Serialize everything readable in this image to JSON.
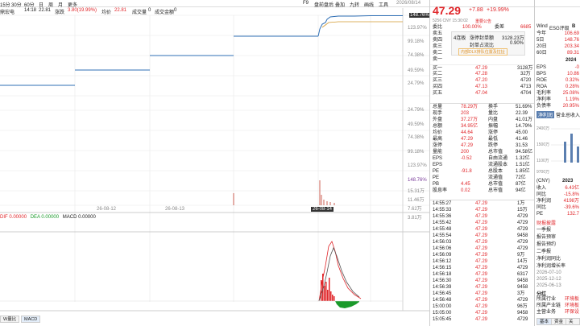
{
  "topbar": {
    "items": [
      "F9",
      "盘前盘后",
      "叠加",
      "九转",
      "画线",
      "工具"
    ],
    "date": "2026/08/14"
  },
  "toolbar": {
    "stock_name": "鼎宏电",
    "periods": [
      "15分",
      "30分",
      "60分",
      "日",
      "周",
      "月",
      "更多"
    ],
    "info": [
      {
        "label": "14:18",
        "value": "22.81"
      },
      {
        "label": "涨跌",
        "value": "3.80(19.99%)"
      },
      {
        "label": "均价",
        "value": "22.81"
      },
      {
        "label": "成交量",
        "value": "0"
      },
      {
        "label": "成交金额",
        "value": "0"
      }
    ]
  },
  "price_axis": {
    "top_labels": [
      "148.76%",
      "123.97%",
      "99.18%",
      "74.38%",
      "49.59%",
      "24.79%"
    ],
    "bottom_labels": [
      "24.79%",
      "49.59%",
      "74.38%",
      "99.18%",
      "123.97%",
      "148.76%",
      "15.31万",
      "11.46万",
      "7.62万",
      "3.81万"
    ]
  },
  "time_axis": [
    "26-08-12",
    "26-08-13",
    "26-08-14"
  ],
  "macd": {
    "legend": [
      {
        "label": "DIF",
        "value": "0.00000",
        "color": "#e0262a"
      },
      {
        "label": "DEA",
        "value": "0.00000",
        "color": "#1a9a2a"
      },
      {
        "label": "MACD",
        "value": "0.00000",
        "color": "#222222"
      }
    ]
  },
  "bottom_tabs": [
    "W量比",
    "MACD"
  ],
  "quote": {
    "price": "47.29",
    "change": "+7.88",
    "change_pct": "+19.99%",
    "sub": "5256 CNY 15:30:02",
    "sub_badge": "重要公告"
  },
  "order_book": {
    "ratio_label": "委比",
    "ratio_value": "100.00%",
    "diff_label": "委差",
    "diff_value": "6685",
    "asks": [
      {
        "label": "卖五",
        "price": "",
        "vol": ""
      },
      {
        "label": "卖四",
        "price": "",
        "vol": ""
      },
      {
        "label": "卖三",
        "price": "",
        "vol": ""
      },
      {
        "label": "卖二",
        "price": "",
        "vol": ""
      },
      {
        "label": "卖一",
        "price": "",
        "vol": ""
      }
    ],
    "popup": {
      "row1": [
        "4连板",
        "涨停封单额",
        "3128.23万"
      ],
      "row2": [
        "",
        "封单占流比",
        "0.90%"
      ],
      "highlight": "内部DLX排队位置及拉扯"
    },
    "bids": [
      {
        "label": "买一",
        "price": "47.29",
        "vol": "3128万"
      },
      {
        "label": "买二",
        "price": "47.28",
        "vol": "32万"
      },
      {
        "label": "买三",
        "price": "47.20",
        "vol": "4720"
      },
      {
        "label": "买四",
        "price": "47.13",
        "vol": "4713"
      },
      {
        "label": "买五",
        "price": "47.04",
        "vol": "4704"
      }
    ]
  },
  "stats": [
    {
      "l1": "总量",
      "v1": "78.29万",
      "l2": "换手",
      "v2": "51.69%"
    },
    {
      "l1": "现手",
      "v1": "203",
      "l2": "量比",
      "v2": "22.39"
    },
    {
      "l1": "外盘",
      "v1": "37.27万",
      "l2": "内盘",
      "v2": "41.01万"
    },
    {
      "l1": "总额",
      "v1": "34.95亿",
      "l2": "振幅",
      "v2": "14.79%"
    },
    {
      "l1": "均价",
      "v1": "44.64",
      "l2": "涨停",
      "v2": "45.00"
    },
    {
      "l1": "最高",
      "v1": "47.29",
      "l2": "最低",
      "v2": "41.46"
    },
    {
      "l1": "涨停",
      "v1": "47.29",
      "l2": "跌停",
      "v2": "31.53"
    },
    {
      "l1": "量能",
      "v1": "200",
      "l2": "总市值",
      "v2": "94.58亿"
    },
    {
      "l1": "EPS",
      "v1": "-0.52",
      "l2": "自由流通",
      "v2": "1.32亿"
    },
    {
      "l1": "EPS",
      "v1": "",
      "l2": "流通股本",
      "v2": "1.51亿"
    },
    {
      "l1": "PE",
      "v1": "-91.8",
      "l2": "总股本",
      "v2": "1.85亿"
    },
    {
      "l1": "PE",
      "v1": "",
      "l2": "流通值",
      "v2": "72亿"
    },
    {
      "l1": "PB",
      "v1": "4.45",
      "l2": "总市值",
      "v2": "87亿"
    },
    {
      "l1": "股息率",
      "v1": "0.02",
      "l2": "总市值",
      "v2": "94亿"
    }
  ],
  "ticks": [
    {
      "t": "14:55:27",
      "p": "47.29",
      "v": "1万"
    },
    {
      "t": "14:55:33",
      "p": "47.29",
      "v": "15万"
    },
    {
      "t": "14:55:36",
      "p": "47.29",
      "v": "4729"
    },
    {
      "t": "14:55:42",
      "p": "47.29",
      "v": "4729"
    },
    {
      "t": "14:55:48",
      "p": "47.29",
      "v": "4729"
    },
    {
      "t": "14:55:54",
      "p": "47.29",
      "v": "9458"
    },
    {
      "t": "14:56:03",
      "p": "47.29",
      "v": "4729"
    },
    {
      "t": "14:56:06",
      "p": "47.29",
      "v": "4729"
    },
    {
      "t": "14:56:09",
      "p": "47.29",
      "v": "9万"
    },
    {
      "t": "14:56:12",
      "p": "47.29",
      "v": "14万"
    },
    {
      "t": "14:56:15",
      "p": "47.29",
      "v": "4729"
    },
    {
      "t": "14:56:18",
      "p": "47.29",
      "v": "6317"
    },
    {
      "t": "14:56:30",
      "p": "47.29",
      "v": "9458"
    },
    {
      "t": "14:56:39",
      "p": "47.29",
      "v": "9458"
    },
    {
      "t": "14:56:45",
      "p": "47.29",
      "v": "3万"
    },
    {
      "t": "14:56:48",
      "p": "47.29",
      "v": "4729"
    },
    {
      "t": "15:00:00",
      "p": "47.29",
      "v": "96万"
    },
    {
      "t": "15:05:00",
      "p": "47.29",
      "v": "9458"
    },
    {
      "t": "15:05:45",
      "p": "47.29",
      "v": "4729"
    }
  ],
  "right_panel": {
    "tabs": [
      "Wind",
      "ESG评级",
      "B"
    ],
    "periods": [
      {
        "label": "今年",
        "value": "106.69"
      },
      {
        "label": "5日",
        "value": "148.76"
      },
      {
        "label": "20日",
        "value": "203.34"
      },
      {
        "label": "60日",
        "value": "89.31"
      }
    ],
    "year": "2024",
    "metrics": [
      {
        "label": "EPS",
        "value": "-0"
      },
      {
        "label": "BPS",
        "value": "10.86"
      },
      {
        "label": "ROE",
        "value": "0.32%"
      },
      {
        "label": "ROA",
        "value": "0.28%"
      },
      {
        "label": "毛利率",
        "value": "25.08%"
      },
      {
        "label": "净利率",
        "value": "1.19%"
      },
      {
        "label": "负债率",
        "value": "20.95%"
      }
    ],
    "sub_tabs": [
      "净利润",
      "营业总收入"
    ],
    "chart_axis": [
      "2400万",
      "1500万",
      "1100万",
      "9700万"
    ],
    "unit": "(CNY)",
    "unit_year": "2023",
    "fin": [
      {
        "label": "收入",
        "value": "6.43亿"
      },
      {
        "label": "同比",
        "value": "-15.8%"
      },
      {
        "label": "净利润",
        "value": "4198万"
      },
      {
        "label": "同比",
        "value": "-39.6%"
      },
      {
        "label": "PE",
        "value": "132.7"
      }
    ],
    "reports_title": "财报披露",
    "reports": [
      "一季报",
      "报告预审",
      "报告预约",
      "二季报",
      "净利润同比",
      "净利润增长率"
    ],
    "dates": [
      "2026-07-10",
      "2025-12-12",
      "2025-06-13"
    ],
    "section": "分红",
    "info": [
      {
        "label": "所属行业",
        "value": "环境板"
      },
      {
        "label": "所属产业链",
        "value": "环境板"
      },
      {
        "label": "主营业务",
        "value": "环保设"
      }
    ],
    "bottom_tabs": [
      "基本",
      "资金",
      "关联"
    ]
  }
}
